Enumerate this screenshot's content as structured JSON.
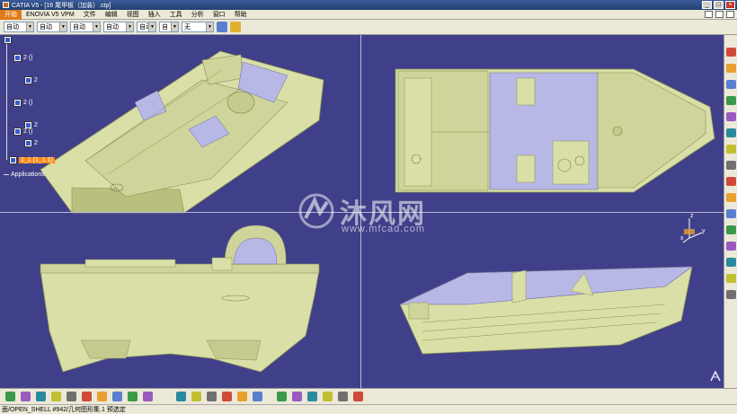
{
  "window": {
    "title": "CATIA V5 - [16 尾甲板（加装）.stp]",
    "minimize": "_",
    "maximize": "□",
    "close": "×"
  },
  "menu": {
    "items": [
      "开始",
      "ENOVIA V5 VPM",
      "文件",
      "编辑",
      "视图",
      "插入",
      "工具",
      "分析",
      "窗口",
      "帮助"
    ]
  },
  "properties_toolbar": {
    "combos": [
      "自动",
      "自动",
      "自动",
      "自动",
      "自动",
      "自",
      "无"
    ]
  },
  "spec_tree": {
    "nodes": [
      "2 ()",
      "2",
      "2 ()",
      "2",
      "2 ()",
      "2",
      "1_1 (1_1.1)"
    ],
    "applications_label": "Applications"
  },
  "watermark": {
    "brand": "沐风网",
    "url": "www.mfcad.com"
  },
  "compass": {
    "x_label": "x",
    "y_label": "y",
    "z_label": "z"
  },
  "status_bar": {
    "text": "面/OPEN_SHELL #942/几何图形集.1 预选定"
  },
  "colors": {
    "viewport_bg": "#40408a",
    "hull": "#d9dfa6",
    "hull_shade": "#b9c07e",
    "deck_lavender": "#b8b8e6",
    "highlight_orange": "#ff8c1a"
  },
  "icons": {
    "right_toolbar": [
      "sketch-icon",
      "pad-icon",
      "pocket-icon",
      "shaft-icon",
      "hole-icon",
      "fillet-icon",
      "chamfer-icon",
      "draft-icon",
      "shell-icon",
      "thickness-icon",
      "rib-icon",
      "slot-icon",
      "measure-icon",
      "light-icon",
      "analysis-icon",
      "plane-icon"
    ],
    "bottom_toolbar": [
      "new-icon",
      "open-icon",
      "save-icon",
      "print-icon",
      "cut-icon",
      "copy-icon",
      "paste-icon",
      "undo-icon",
      "redo-icon",
      "help-icon",
      "fly-icon",
      "fit-all-icon",
      "pan-icon",
      "rotate-icon",
      "zoom-in-icon",
      "zoom-out-icon",
      "normal-view-icon",
      "iso-view-icon",
      "shading-icon",
      "hide-show-icon",
      "swap-icon",
      "measure-icon"
    ]
  }
}
